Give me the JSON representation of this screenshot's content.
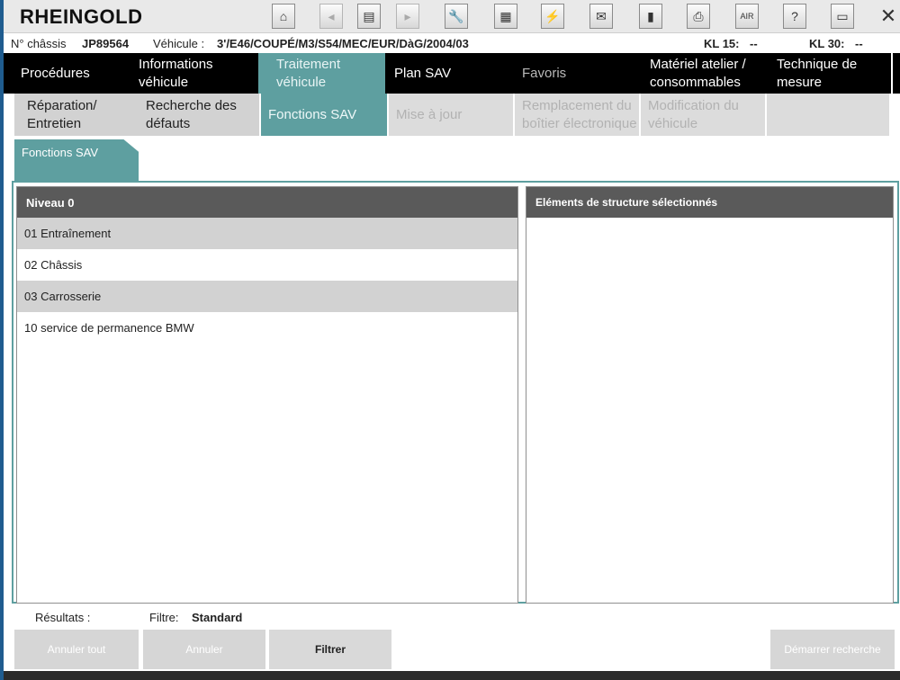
{
  "app": {
    "title": "RHEINGOLD"
  },
  "toolbar": {
    "icons": [
      {
        "name": "home-icon",
        "glyph": "⌂",
        "enabled": true
      },
      {
        "name": "back-icon",
        "glyph": "◂",
        "enabled": false
      },
      {
        "name": "document-icon",
        "glyph": "▤",
        "enabled": true
      },
      {
        "name": "forward-icon",
        "glyph": "▸",
        "enabled": false
      },
      {
        "name": "wrench-icon",
        "glyph": "🔧",
        "enabled": true
      },
      {
        "name": "diagnostics-icon",
        "glyph": "▦",
        "enabled": true
      },
      {
        "name": "connection-icon",
        "glyph": "⚡",
        "enabled": true
      },
      {
        "name": "mail-icon",
        "glyph": "✉",
        "enabled": true
      },
      {
        "name": "battery-icon",
        "glyph": "▮",
        "enabled": true
      },
      {
        "name": "printer-icon",
        "glyph": "⎙",
        "enabled": true
      },
      {
        "name": "air-search-icon",
        "glyph": "AIR",
        "enabled": true
      },
      {
        "name": "help-icon",
        "glyph": "?",
        "enabled": true
      },
      {
        "name": "minimize-window-icon",
        "glyph": "▭",
        "enabled": true
      }
    ],
    "close_glyph": "✕"
  },
  "info": {
    "chassis_label": "N° châssis",
    "chassis_value": "JP89564",
    "vehicle_label": "Véhicule :",
    "vehicle_value": "3'/E46/COUPÉ/M3/S54/MEC/EUR/DàG/2004/03",
    "kl15_label": "KL 15:",
    "kl15_value": "--",
    "kl30_label": "KL 30:",
    "kl30_value": "--"
  },
  "nav_main": [
    {
      "label": "Procédures",
      "state": "normal"
    },
    {
      "label": "Informations véhicule",
      "state": "normal"
    },
    {
      "label": "Traitement véhicule",
      "state": "active"
    },
    {
      "label": "Plan SAV",
      "state": "normal"
    },
    {
      "label": "Favoris",
      "state": "dim"
    },
    {
      "label": "Matériel atelier / consommables",
      "state": "normal"
    },
    {
      "label": "Technique de mesure",
      "state": "normal"
    }
  ],
  "nav_sub": [
    {
      "label": "Réparation/ Entretien",
      "state": "normal"
    },
    {
      "label": "Recherche des défauts",
      "state": "normal"
    },
    {
      "label": "Fonctions SAV",
      "state": "active"
    },
    {
      "label": "Mise à jour",
      "state": "disabled"
    },
    {
      "label": "Remplacement du boîtier électronique",
      "state": "disabled"
    },
    {
      "label": "Modification du véhicule",
      "state": "disabled"
    },
    {
      "label": "",
      "state": "disabled"
    }
  ],
  "folder_tab": {
    "label": "Fonctions SAV"
  },
  "left_panel": {
    "header": "Niveau 0",
    "items": [
      "01 Entraînement",
      "02 Châssis",
      "03 Carrosserie",
      "10 service de permanence BMW"
    ]
  },
  "right_panel": {
    "header": "Eléments de structure sélectionnés"
  },
  "footer": {
    "results_label": "Résultats :",
    "filter_label": "Filtre:",
    "filter_value": "Standard",
    "buttons": {
      "cancel_all": "Annuler tout",
      "cancel": "Annuler",
      "filter": "Filtrer",
      "start_search": "Démarrer recherche"
    }
  },
  "colors": {
    "accent": "#5e9fa0",
    "nav_bg": "#000000",
    "header_bg": "#5a5a5a",
    "row_alt": "#d2d2d2"
  }
}
